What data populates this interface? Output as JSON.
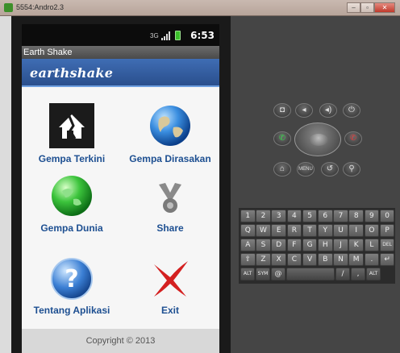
{
  "window": {
    "title": "5554:Andro2.3",
    "min_label": "–",
    "max_label": "▫",
    "close_label": "✕"
  },
  "status_bar": {
    "time": "6:53",
    "data_label": "3G"
  },
  "app": {
    "bar_title": "Earth Shake",
    "logo_text": "earthshake",
    "menu": [
      {
        "label": "Gempa Terkini",
        "icon": "broken-house-icon"
      },
      {
        "label": "Gempa Dirasakan",
        "icon": "globe-icon"
      },
      {
        "label": "Gempa Dunia",
        "icon": "green-globe-icon"
      },
      {
        "label": "Share",
        "icon": "share-icon"
      },
      {
        "label": "Tentang Aplikasi",
        "icon": "help-icon"
      },
      {
        "label": "Exit",
        "icon": "red-x-icon"
      }
    ],
    "footer": "Copyright © 2013"
  },
  "emulator": {
    "top_buttons": [
      "camera",
      "vol-down",
      "vol-up",
      "power"
    ],
    "call_button": "call-icon",
    "end_button": "end-call-icon",
    "bottom_buttons": [
      "home",
      "MENU",
      "back",
      "search"
    ],
    "keyboard_rows": [
      [
        "1",
        "2",
        "3",
        "4",
        "5",
        "6",
        "7",
        "8",
        "9",
        "0"
      ],
      [
        "Q",
        "W",
        "E",
        "R",
        "T",
        "Y",
        "U",
        "I",
        "O",
        "P"
      ],
      [
        "A",
        "S",
        "D",
        "F",
        "G",
        "H",
        "J",
        "K",
        "L",
        "DEL"
      ],
      [
        "⇧",
        "Z",
        "X",
        "C",
        "V",
        "B",
        "N",
        "M",
        ".",
        "↵"
      ],
      [
        "ALT",
        "SYM",
        "@",
        "",
        "/",
        ",",
        "ALT"
      ]
    ]
  },
  "colors": {
    "header_blue": "#2a4f8d",
    "label_blue": "#1d4f91",
    "status_bg": "#0c0c0c"
  }
}
